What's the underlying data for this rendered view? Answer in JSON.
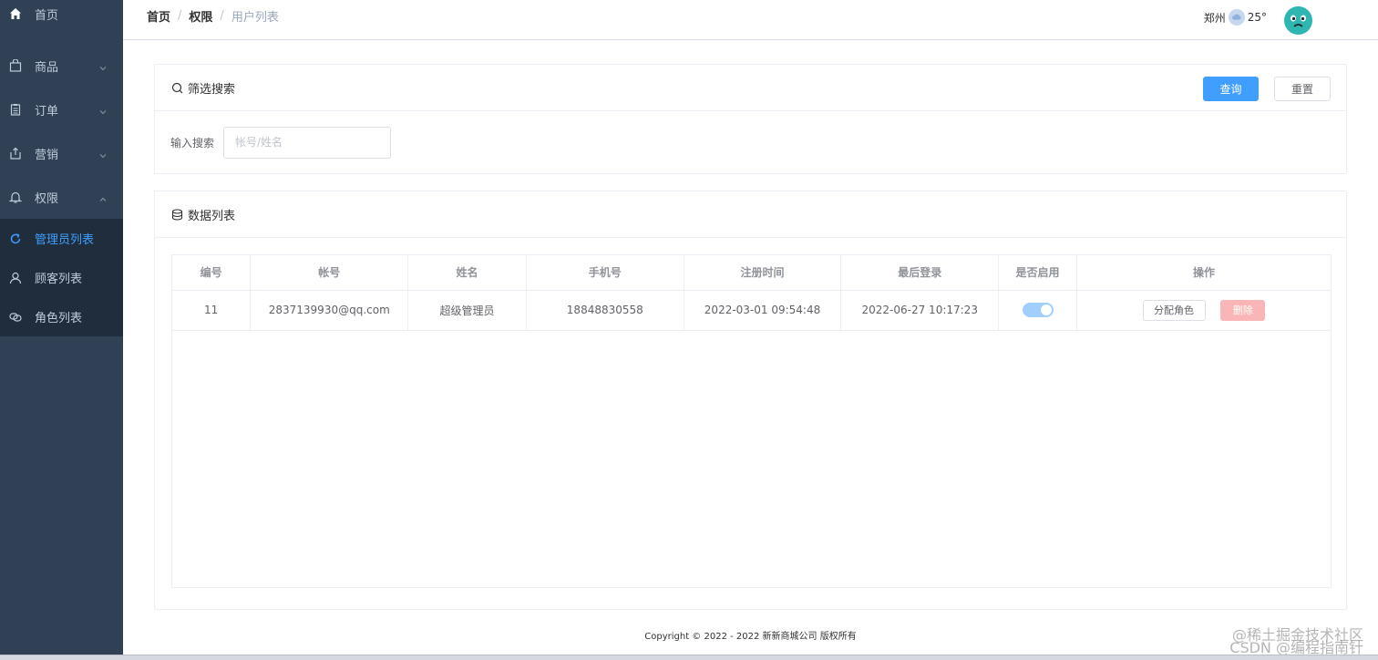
{
  "sidebar": {
    "home": "首页",
    "items": [
      {
        "label": "商品",
        "icon": "shopping-bag-icon"
      },
      {
        "label": "订单",
        "icon": "clipboard-icon"
      },
      {
        "label": "营销",
        "icon": "share-icon"
      },
      {
        "label": "权限",
        "icon": "bell-icon"
      }
    ],
    "sub_items": [
      {
        "label": "管理员列表",
        "icon": "refresh-icon",
        "active": true
      },
      {
        "label": "顾客列表",
        "icon": "user-icon"
      },
      {
        "label": "角色列表",
        "icon": "link-icon"
      }
    ]
  },
  "header": {
    "breadcrumb": [
      "首页",
      "权限",
      "用户列表"
    ],
    "weather_city": "郑州",
    "weather_temp": "25°"
  },
  "filter": {
    "title": "筛选搜索",
    "query_button": "查询",
    "reset_button": "重置",
    "search_label": "输入搜索",
    "search_placeholder": "帐号/姓名",
    "search_value": ""
  },
  "list": {
    "title": "数据列表",
    "columns": [
      "编号",
      "帐号",
      "姓名",
      "手机号",
      "注册时间",
      "最后登录",
      "是否启用",
      "操作"
    ],
    "rows": [
      {
        "id": "11",
        "account": "2837139930@qq.com",
        "name": "超级管理员",
        "phone": "18848830558",
        "register_time": "2022-03-01 09:54:48",
        "last_login": "2022-06-27 10:17:23",
        "enabled": true
      }
    ],
    "assign_role_button": "分配角色",
    "delete_button": "删除"
  },
  "footer": {
    "copyright": "Copyright © 2022 - 2022 新新商城公司 版权所有"
  },
  "watermark": {
    "line1": "@稀土掘金技术社区",
    "line2": "CSDN @编程指南针"
  },
  "colors": {
    "sidebar_bg": "#304156",
    "submenu_bg": "#1f2d3d",
    "primary": "#409eff",
    "danger_light": "#fab6b6"
  }
}
